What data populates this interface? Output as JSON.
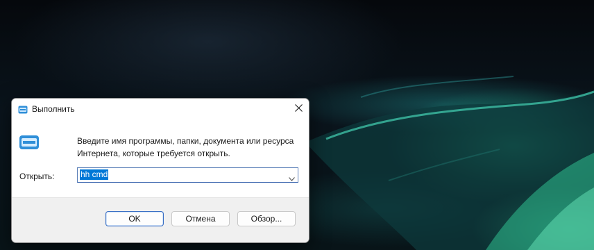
{
  "dialog": {
    "title": "Выполнить",
    "description_line1": "Введите имя программы, папки, документа или ресурса",
    "description_line2": "Интернета, которые требуется открыть.",
    "open_label": "Открыть:",
    "command_value": "hh cmd",
    "ok_label": "OK",
    "cancel_label": "Отмена",
    "browse_label": "Обзор...",
    "icons": {
      "title": "run-icon",
      "main": "run-icon",
      "close": "close-icon",
      "dropdown": "chevron-down-icon"
    },
    "colors": {
      "selection": "#0078d7",
      "primary_border": "#3a6fc4"
    }
  }
}
